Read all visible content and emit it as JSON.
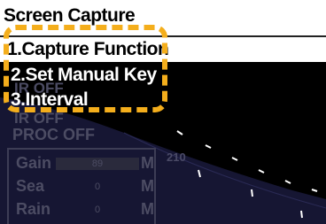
{
  "menu": {
    "title": "Screen Capture",
    "items": [
      {
        "label": "1.Capture Function",
        "selected": true
      },
      {
        "label": "2.Set Manual Key",
        "selected": false
      },
      {
        "label": "3.Interval",
        "selected": false
      }
    ]
  },
  "background": {
    "ir_off": "IR OFF",
    "ir_off_2": "IR OFF",
    "proc_off": "PROC OFF",
    "bearing_label": "210",
    "gain": {
      "label": "Gain",
      "value": "89",
      "unit": "M"
    },
    "sea": {
      "label": "Sea",
      "value": "0",
      "unit": "M"
    },
    "rain": {
      "label": "Rain",
      "value": "0",
      "unit": "M"
    }
  },
  "colors": {
    "highlight": "#f4ae1c",
    "radar_sweep": "#1b1b3a",
    "dim_text": "#4c4c63"
  }
}
